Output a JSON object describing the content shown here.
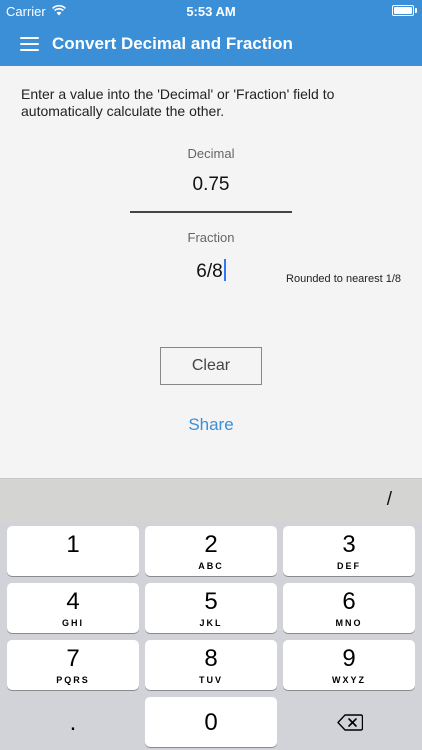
{
  "status_bar": {
    "carrier": "Carrier",
    "time": "5:53 AM"
  },
  "nav": {
    "title": "Convert Decimal and Fraction",
    "menu_icon": "hamburger-menu-icon"
  },
  "intro_text": "Enter a value into the 'Decimal' or 'Fraction' field to automatically calculate the other.",
  "decimal": {
    "label": "Decimal",
    "value": "0.75"
  },
  "fraction": {
    "label": "Fraction",
    "value": "6/8",
    "note": "Rounded to nearest 1/8"
  },
  "buttons": {
    "clear": "Clear",
    "share": "Share"
  },
  "accessory": {
    "slash": "/"
  },
  "keypad": [
    {
      "digit": "1",
      "letters": ""
    },
    {
      "digit": "2",
      "letters": "ABC"
    },
    {
      "digit": "3",
      "letters": "DEF"
    },
    {
      "digit": "4",
      "letters": "GHI"
    },
    {
      "digit": "5",
      "letters": "JKL"
    },
    {
      "digit": "6",
      "letters": "MNO"
    },
    {
      "digit": "7",
      "letters": "PQRS"
    },
    {
      "digit": "8",
      "letters": "TUV"
    },
    {
      "digit": "9",
      "letters": "WXYZ"
    }
  ],
  "bottom_row": {
    "dot": ".",
    "zero": "0"
  },
  "colors": {
    "brand": "#3a8fd6",
    "background": "#f4f4f4",
    "keyboard": "#d1d3d9",
    "caret": "#3478f6"
  }
}
